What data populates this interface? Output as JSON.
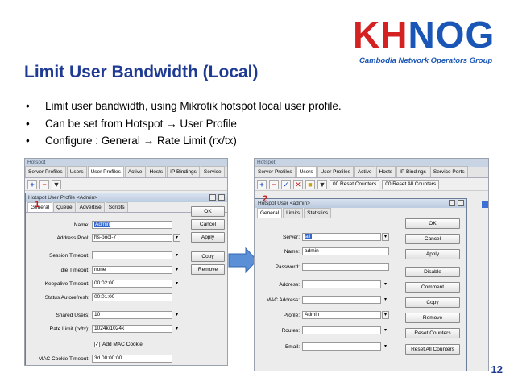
{
  "slide": {
    "title": "Limit User Bandwidth (Local)",
    "bullets": [
      "Limit user bandwidth, using Mikrotik hotspot local user profile.",
      "Can be set from Hotspot → User Profile",
      "Configure : General → Rate Limit (rx/tx)"
    ],
    "page_number": "12"
  },
  "logo": {
    "main_k": "KH",
    "main_rest": "NOG",
    "subtitle": "Cambodia Network Operators Group"
  },
  "left_window": {
    "title": "Hotspot",
    "tabs": [
      "Server Profiles",
      "Users",
      "User Profiles",
      "Active",
      "Hosts",
      "IP Bindings",
      "Service"
    ],
    "marker": "1",
    "dialog": {
      "title": "Hotspot User Profile <Admin>",
      "tabs": [
        "General",
        "Queue",
        "Advertise",
        "Scripts"
      ],
      "fields": {
        "name_label": "Name:",
        "name_value": "Admin",
        "pool_label": "Address Pool:",
        "pool_value": "hs-pool-7",
        "session_label": "Session Timeout:",
        "session_value": "",
        "idle_label": "Idle Timeout:",
        "idle_value": "none",
        "keepalive_label": "Keepalive Timeout:",
        "keepalive_value": "00:02:00",
        "status_label": "Status Autorefresh:",
        "status_value": "00:01:00",
        "shared_label": "Shared Users:",
        "shared_value": "10",
        "rate_label": "Rate Limit (rx/tx):",
        "rate_value": "1024k/1024k",
        "mac_cookie_label": "Add MAC Cookie",
        "mac_timeout_label": "MAC Cookie Timeout:",
        "mac_timeout_value": "3d 00:00:00"
      },
      "buttons": [
        "OK",
        "Cancel",
        "Apply",
        "Copy",
        "Remove"
      ]
    }
  },
  "right_window": {
    "title": "Hotspot",
    "tabs": [
      "Server Profiles",
      "Users",
      "User Profiles",
      "Active",
      "Hosts",
      "IP Bindings",
      "Service Ports"
    ],
    "toolbar": {
      "reset_counters": "Reset Counters",
      "reset_all": "Reset All Counters"
    },
    "marker": "2",
    "dialog": {
      "title": "Hotspot User <admin>",
      "tabs": [
        "General",
        "Limits",
        "Statistics"
      ],
      "fields": {
        "server_label": "Server:",
        "server_value": "all",
        "name_label": "Name:",
        "name_value": "admin",
        "password_label": "Password:",
        "password_value": "",
        "address_label": "Address:",
        "address_value": "",
        "mac_label": "MAC Address:",
        "mac_value": "",
        "profile_label": "Profile:",
        "profile_value": "Admin",
        "routes_label": "Routes:",
        "routes_value": "",
        "email_label": "Email:",
        "email_value": ""
      },
      "buttons": [
        "OK",
        "Cancel",
        "Apply",
        "Disable",
        "Comment",
        "Copy",
        "Remove",
        "Reset Counters",
        "Reset All Counters"
      ]
    }
  }
}
